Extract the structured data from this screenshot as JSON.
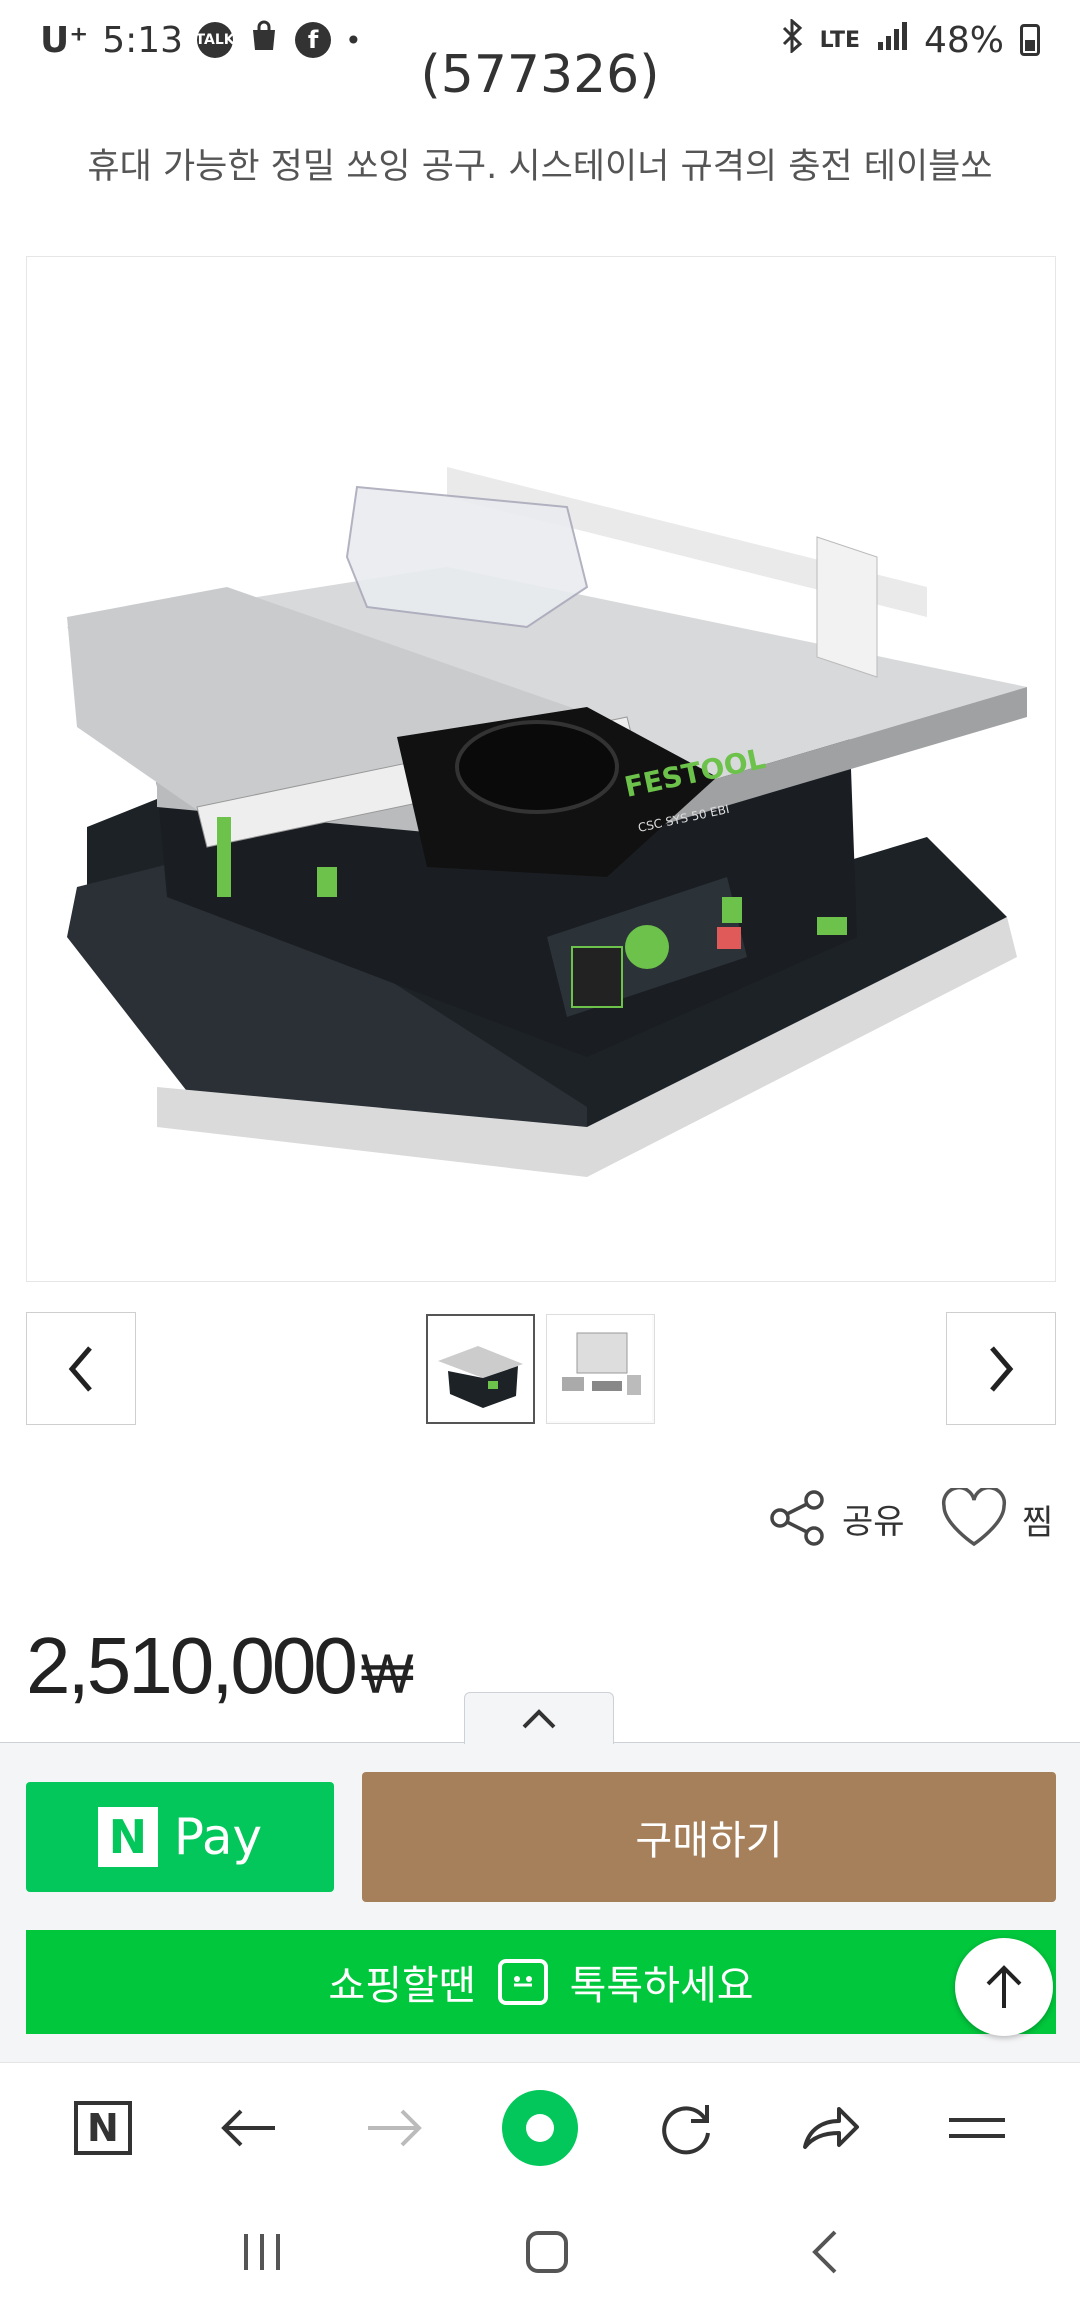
{
  "status_bar": {
    "carrier": "U⁺",
    "time": "5:13",
    "network": "LTE",
    "battery": "48%"
  },
  "product": {
    "title_fragment": "(577326)",
    "subtitle": "휴대 가능한 정밀 쏘잉 공구. 시스테이너 규격의 충전 테이블쏘",
    "price_value": "2,510,000",
    "price_unit": "₩",
    "thumbnail_count": 2,
    "active_thumbnail": 1
  },
  "actions": {
    "share_label": "공유",
    "like_label": "찜"
  },
  "purchase": {
    "npay_logo": "N",
    "npay_label": "Pay",
    "buy_label": "구매하기",
    "talk_prefix": "쇼핑할땐",
    "talk_suffix": "톡톡하세요"
  },
  "browser_toolbar": {
    "items": [
      "naver-home",
      "back",
      "forward",
      "green-dot",
      "reload",
      "share",
      "menu"
    ],
    "home_label": "N"
  },
  "colors": {
    "npay_green": "#03c75a",
    "talk_green": "#00c73c",
    "buy_brown": "#a6805b",
    "festool_green": "#6cc24a"
  }
}
